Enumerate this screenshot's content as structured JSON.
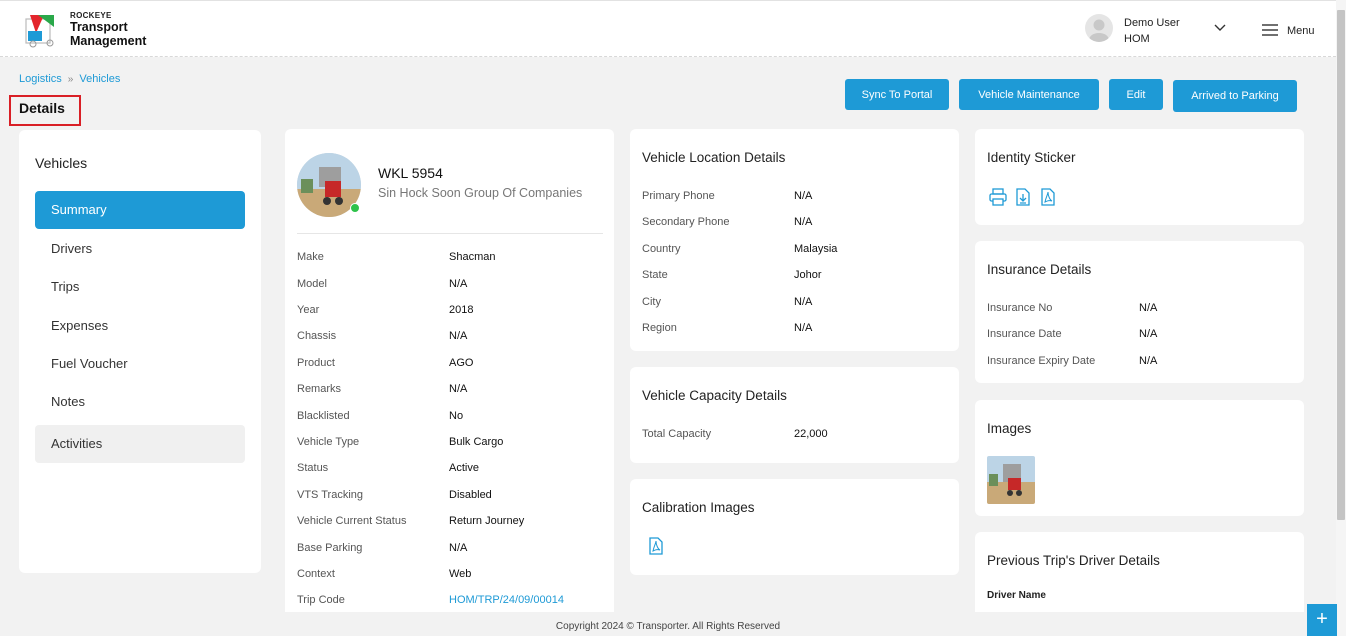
{
  "header": {
    "brand_small": "ROCKEYE",
    "brand_line1": "Transport",
    "brand_line2": "Management",
    "user_name": "Demo User",
    "user_branch": "HOM",
    "menu_label": "Menu"
  },
  "breadcrumb": {
    "item1": "Logistics",
    "item2": "Vehicles"
  },
  "page_title": "Details",
  "actions": {
    "sync": "Sync To Portal",
    "maintenance": "Vehicle Maintenance",
    "edit": "Edit",
    "arrived": "Arrived to Parking"
  },
  "sidebar": {
    "title": "Vehicles",
    "items": [
      "Summary",
      "Drivers",
      "Trips",
      "Expenses",
      "Fuel Voucher",
      "Notes",
      "Activities"
    ]
  },
  "vehicle": {
    "plate": "WKL 5954",
    "company": "Sin Hock Soon Group Of Companies",
    "details": [
      {
        "label": "Make",
        "value": "Shacman"
      },
      {
        "label": "Model",
        "value": "N/A"
      },
      {
        "label": "Year",
        "value": "2018"
      },
      {
        "label": "Chassis",
        "value": "N/A"
      },
      {
        "label": "Product",
        "value": "AGO"
      },
      {
        "label": "Remarks",
        "value": "N/A"
      },
      {
        "label": "Blacklisted",
        "value": "No"
      },
      {
        "label": "Vehicle Type",
        "value": "Bulk Cargo"
      },
      {
        "label": "Status",
        "value": "Active"
      },
      {
        "label": "VTS Tracking",
        "value": "Disabled"
      },
      {
        "label": "Vehicle Current Status",
        "value": "Return Journey"
      },
      {
        "label": "Base Parking",
        "value": "N/A"
      },
      {
        "label": "Context",
        "value": "Web"
      },
      {
        "label": "Trip Code",
        "value": "HOM/TRP/24/09/00014"
      }
    ]
  },
  "location": {
    "title": "Vehicle Location Details",
    "rows": [
      {
        "label": "Primary Phone",
        "value": "N/A"
      },
      {
        "label": "Secondary Phone",
        "value": "N/A"
      },
      {
        "label": "Country",
        "value": "Malaysia"
      },
      {
        "label": "State",
        "value": "Johor"
      },
      {
        "label": "City",
        "value": "N/A"
      },
      {
        "label": "Region",
        "value": "N/A"
      }
    ]
  },
  "capacity": {
    "title": "Vehicle Capacity Details",
    "label": "Total Capacity",
    "value": "22,000"
  },
  "calibration": {
    "title": "Calibration Images"
  },
  "sticker": {
    "title": "Identity Sticker"
  },
  "insurance": {
    "title": "Insurance Details",
    "rows": [
      {
        "label": "Insurance No",
        "value": "N/A"
      },
      {
        "label": "Insurance Date",
        "value": "N/A"
      },
      {
        "label": "Insurance Expiry Date",
        "value": "N/A"
      }
    ]
  },
  "images": {
    "title": "Images"
  },
  "previous_driver": {
    "title": "Previous Trip's Driver Details",
    "field_label": "Driver Name"
  },
  "footer": "Copyright 2024 © Transporter. All Rights Reserved",
  "colors": {
    "accent": "#1e9ad6",
    "highlight": "#d91f26",
    "online": "#2ec24a"
  },
  "icons": [
    "printer-icon",
    "download-file-icon",
    "pdf-icon",
    "user-avatar-icon",
    "chevron-down-icon",
    "hamburger-menu-icon",
    "plus-icon"
  ]
}
